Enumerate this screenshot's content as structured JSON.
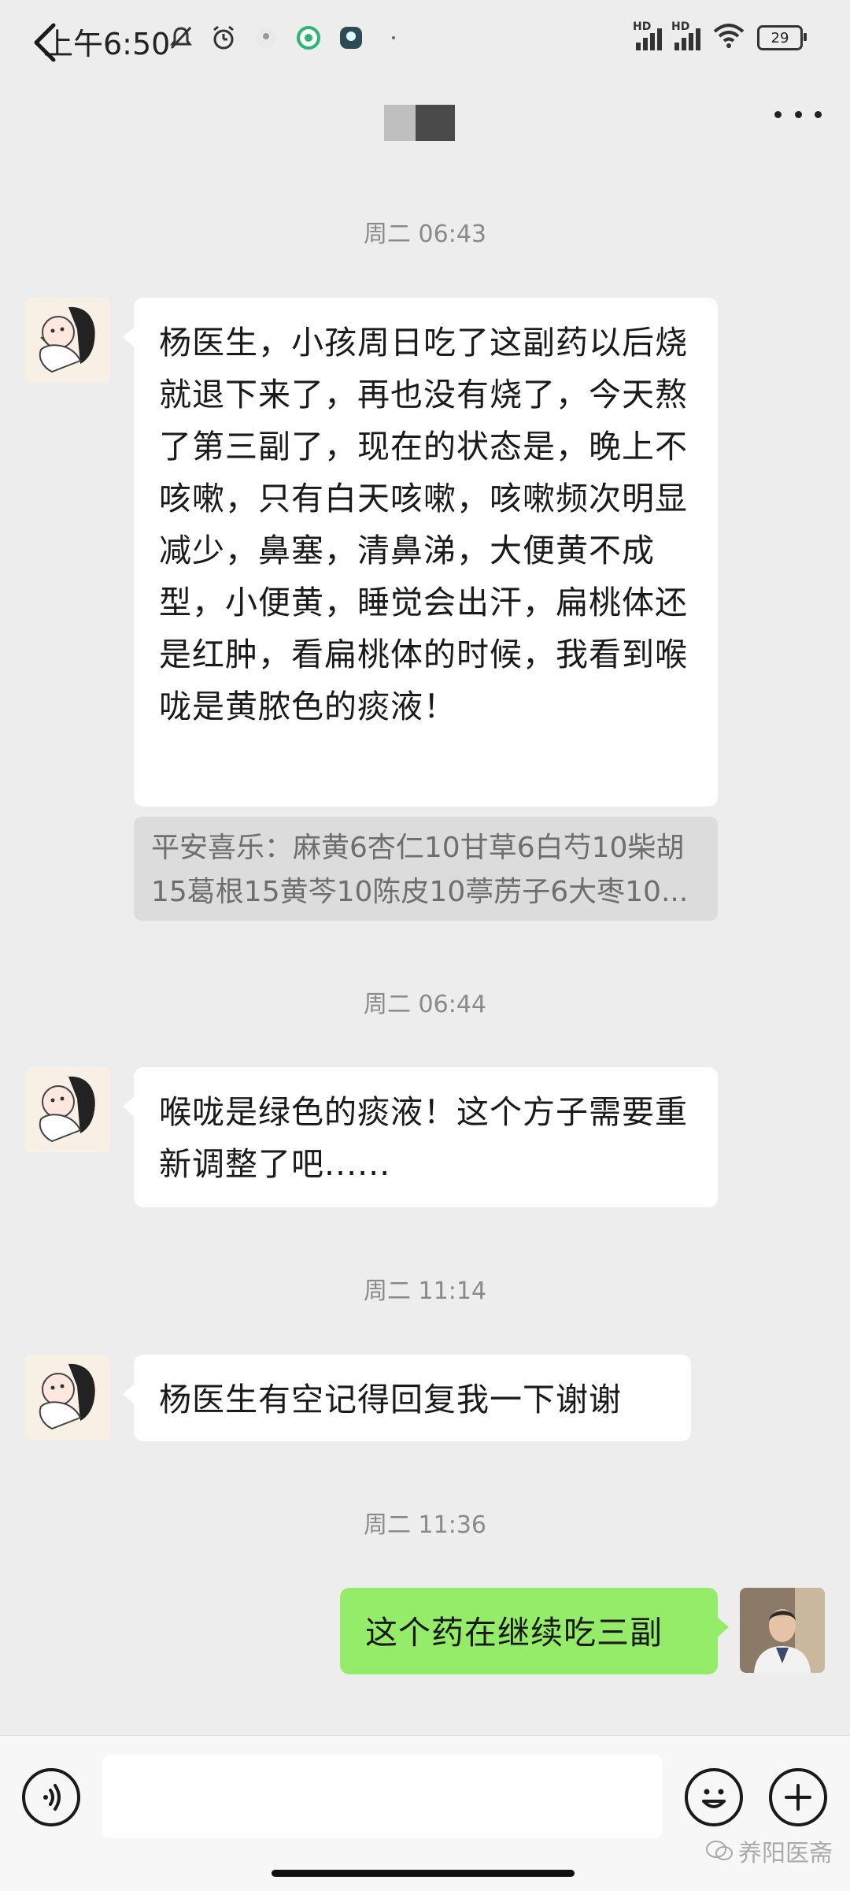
{
  "status_bar": {
    "time": "上午6:50",
    "hd1": "HD",
    "hd2": "HD",
    "battery": "29"
  },
  "header": {
    "back_icon": "chevron-left-icon",
    "more_icon": "more-dots-icon"
  },
  "messages": [
    {
      "timestamp": "周二 06:43"
    },
    {
      "sender": "patient",
      "text": "杨医生，小孩周日吃了这副药以后烧就退下来了，再也没有烧了，今天熬了第三副了，现在的状态是，晚上不咳嗽，只有白天咳嗽，咳嗽频次明显减少，鼻塞，清鼻涕，大便黄不成型，小便黄，睡觉会出汗，扁桃体还是红肿，看扁桃体的时候，我看到喉咙是黄脓色的痰液！"
    },
    {
      "quote": "平安喜乐：麻黄6杏仁10甘草6白芍10柴胡15葛根15黄芩10陈皮10葶苈子6大枣10..."
    },
    {
      "timestamp": "周二 06:44"
    },
    {
      "sender": "patient",
      "text": "喉咙是绿色的痰液！这个方子需要重新调整了吧......"
    },
    {
      "timestamp": "周二 11:14"
    },
    {
      "sender": "patient",
      "text": "杨医生有空记得回复我一下谢谢"
    },
    {
      "timestamp": "周二 11:36"
    },
    {
      "sender": "doctor",
      "text": "这个药在继续吃三副"
    }
  ],
  "input_bar": {
    "voice_icon": "voice-icon",
    "emoji_icon": "emoji-icon",
    "plus_icon": "plus-icon"
  },
  "watermark": "养阳医斋",
  "colors": {
    "background": "#ededed",
    "bubble_self": "#95ec69",
    "bubble_other": "#ffffff"
  }
}
